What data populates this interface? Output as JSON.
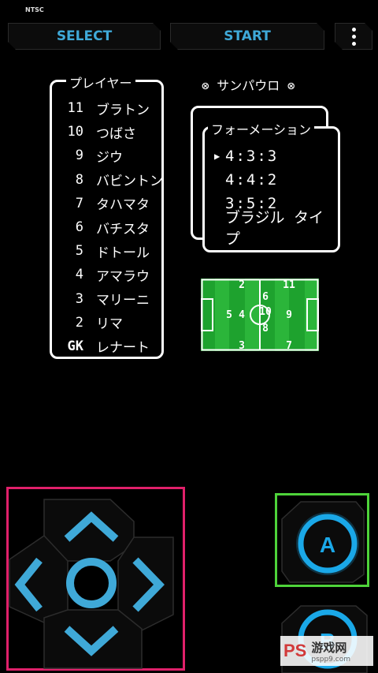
{
  "top_bar": {
    "ntsc_label": "NTSC",
    "select_label": "SELECT",
    "start_label": "START"
  },
  "game": {
    "players_title": "プレイヤー",
    "players": [
      {
        "number": "11",
        "name": "ブラトン"
      },
      {
        "number": "10",
        "name": "つばさ"
      },
      {
        "number": "9",
        "name": "ジウ"
      },
      {
        "number": "8",
        "name": "バビントン"
      },
      {
        "number": "7",
        "name": "タハマタ"
      },
      {
        "number": "6",
        "name": "バチスタ"
      },
      {
        "number": "5",
        "name": "ドトール"
      },
      {
        "number": "4",
        "name": "アマラウ"
      },
      {
        "number": "3",
        "name": "マリーニ"
      },
      {
        "number": "2",
        "name": "リマ"
      },
      {
        "number": "GK",
        "name": "レナート"
      }
    ],
    "team_name": "⊗ サンパウロ ⊗",
    "formation_title": "フォーメーション",
    "formations": [
      "4:3:3",
      "4:4:2",
      "3:5:2",
      "ブラジル タイプ"
    ],
    "selected_formation_index": 0,
    "field_numbers": [
      "2",
      "11",
      "6",
      "5",
      "4",
      "10",
      "9",
      "8",
      "3",
      "7"
    ]
  },
  "controls": {
    "a_label": "A",
    "b_label": "B",
    "watermark_text": "游戏网",
    "watermark_site": "pspp9.com"
  },
  "colors": {
    "accent": "#3fa9d8",
    "dpad_highlight": "#e0206a",
    "a_highlight": "#4ed33a",
    "field_green": "#1ea22e"
  }
}
